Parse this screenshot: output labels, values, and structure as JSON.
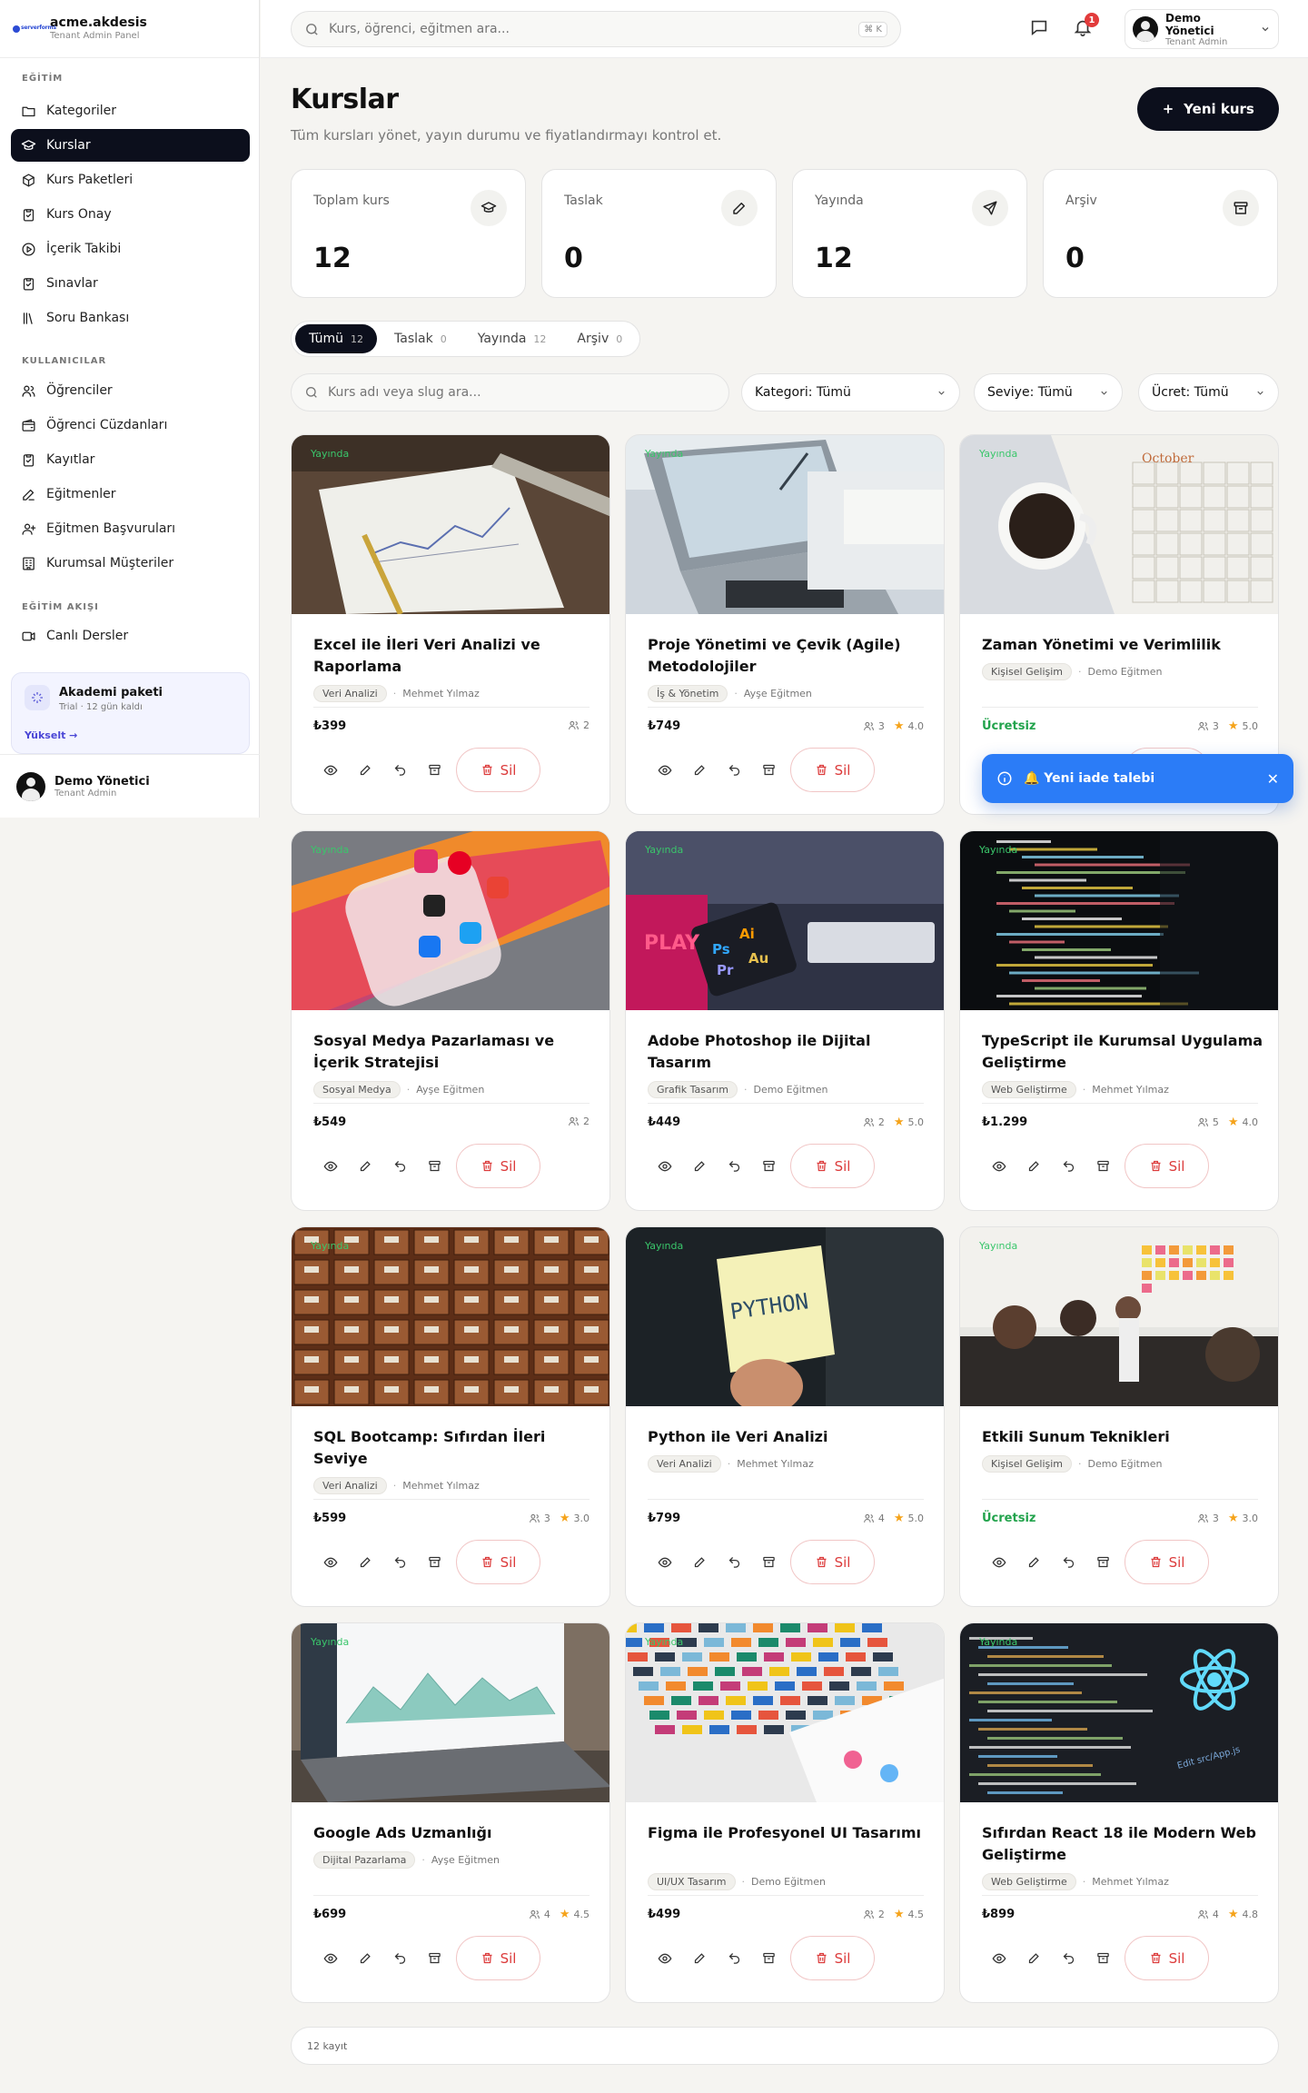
{
  "brand": {
    "logo_text": "serverforms",
    "name": "acme.akdesis",
    "sub": "Tenant Admin Panel"
  },
  "sidebar": {
    "sections": [
      "EĞİTİM",
      "KULLANICILAR",
      "EĞİTİM AKIŞI"
    ],
    "items": [
      {
        "label": "Kategoriler",
        "icon": "folder-icon"
      },
      {
        "label": "Kurslar",
        "icon": "graduation-cap-icon",
        "active": true
      },
      {
        "label": "Kurs Paketleri",
        "icon": "package-icon"
      },
      {
        "label": "Kurs Onay",
        "icon": "clipboard-check-icon"
      },
      {
        "label": "İçerik Takibi",
        "icon": "play-circle-icon"
      },
      {
        "label": "Sınavlar",
        "icon": "clipboard-icon"
      },
      {
        "label": "Soru Bankası",
        "icon": "library-icon"
      },
      {
        "label": "Öğrenciler",
        "icon": "users-icon"
      },
      {
        "label": "Öğrenci Cüzdanları",
        "icon": "wallet-icon"
      },
      {
        "label": "Kayıtlar",
        "icon": "clipboard-list-icon"
      },
      {
        "label": "Eğitmenler",
        "icon": "pen-icon"
      },
      {
        "label": "Eğitmen Başvuruları",
        "icon": "user-plus-icon"
      },
      {
        "label": "Kurumsal Müşteriler",
        "icon": "building-icon"
      },
      {
        "label": "Canlı Dersler",
        "icon": "video-icon"
      }
    ],
    "promo": {
      "title": "Akademi paketi",
      "sub": "Trial · 12 gün kaldı",
      "link": "Yükselt →"
    },
    "user": {
      "name": "Demo Yönetici",
      "role": "Tenant Admin"
    }
  },
  "topbar": {
    "search_placeholder": "Kurs, öğrenci, eğitmen ara...",
    "kbd": "⌘ K",
    "notifications": "1",
    "user": {
      "name": "Demo Yönetici",
      "role": "Tenant Admin"
    }
  },
  "page": {
    "title": "Kurslar",
    "subtitle": "Tüm kursları yönet, yayın durumu ve fiyatlandırmayı kontrol et.",
    "new_button": "Yeni kurs"
  },
  "stats": [
    {
      "label": "Toplam kurs",
      "value": "12",
      "icon": "graduation-cap-icon"
    },
    {
      "label": "Taslak",
      "value": "0",
      "icon": "pencil-icon"
    },
    {
      "label": "Yayında",
      "value": "12",
      "icon": "send-icon"
    },
    {
      "label": "Arşiv",
      "value": "0",
      "icon": "archive-icon"
    }
  ],
  "tabs": [
    {
      "label": "Tümü",
      "count": "12",
      "active": true
    },
    {
      "label": "Taslak",
      "count": "0"
    },
    {
      "label": "Yayında",
      "count": "12"
    },
    {
      "label": "Arşiv",
      "count": "0"
    }
  ],
  "filters": {
    "search_placeholder": "Kurs adı veya slug ara...",
    "category": "Kategori: Tümü",
    "level": "Seviye: Tümü",
    "price": "Ücret: Tümü"
  },
  "status_label": "Yayında",
  "delete_label": "Sil",
  "courses": [
    {
      "title": "Excel ile İleri Veri Analizi ve Raporlama",
      "tag": "Veri Analizi",
      "instructor": "Mehmet Yılmaz",
      "price": "₺399",
      "students": "2",
      "rating": "",
      "theme": "chart"
    },
    {
      "title": "Proje Yönetimi ve Çevik (Agile) Metodolojiler",
      "tag": "İş & Yönetim",
      "instructor": "Ayşe Eğitmen",
      "price": "₺749",
      "students": "3",
      "rating": "4.0",
      "theme": "laptop"
    },
    {
      "title": "Zaman Yönetimi ve Verimlilik",
      "tag": "Kişisel Gelişim",
      "instructor": "Demo Eğitmen",
      "price": "Ücretsiz",
      "free": true,
      "students": "3",
      "rating": "5.0",
      "theme": "calendar"
    },
    {
      "title": "Sosyal Medya Pazarlaması ve İçerik Stratejisi",
      "tag": "Sosyal Medya",
      "instructor": "Ayşe Eğitmen",
      "price": "₺549",
      "students": "2",
      "rating": "",
      "theme": "social"
    },
    {
      "title": "Adobe Photoshop ile Dijital Tasarım",
      "tag": "Grafik Tasarım",
      "instructor": "Demo Eğitmen",
      "price": "₺449",
      "students": "2",
      "rating": "5.0",
      "theme": "adobe"
    },
    {
      "title": "TypeScript ile Kurumsal Uygulama Geliştirme",
      "tag": "Web Geliştirme",
      "instructor": "Mehmet Yılmaz",
      "price": "₺1.299",
      "students": "5",
      "rating": "4.0",
      "theme": "code"
    },
    {
      "title": "SQL Bootcamp: Sıfırdan İleri Seviye",
      "tag": "Veri Analizi",
      "instructor": "Mehmet Yılmaz",
      "price": "₺599",
      "students": "3",
      "rating": "3.0",
      "theme": "drawers"
    },
    {
      "title": "Python ile Veri Analizi",
      "tag": "Veri Analizi",
      "instructor": "Mehmet Yılmaz",
      "price": "₺799",
      "students": "4",
      "rating": "5.0",
      "theme": "python"
    },
    {
      "title": "Etkili Sunum Teknikleri",
      "tag": "Kişisel Gelişim",
      "instructor": "Demo Eğitmen",
      "price": "Ücretsiz",
      "free": true,
      "students": "3",
      "rating": "3.0",
      "theme": "meeting"
    },
    {
      "title": "Google Ads Uzmanlığı",
      "tag": "Dijital Pazarlama",
      "instructor": "Ayşe Eğitmen",
      "price": "₺699",
      "students": "4",
      "rating": "4.5",
      "theme": "analytics"
    },
    {
      "title": "Figma ile Profesyonel UI Tasarımı",
      "tag": "UI/UX Tasarım",
      "instructor": "Demo Eğitmen",
      "price": "₺499",
      "students": "2",
      "rating": "4.5",
      "theme": "swatches"
    },
    {
      "title": "Sıfırdan React 18 ile Modern Web Geliştirme",
      "tag": "Web Geliştirme",
      "instructor": "Mehmet Yılmaz",
      "price": "₺899",
      "students": "4",
      "rating": "4.8",
      "theme": "react"
    }
  ],
  "toast": {
    "text": "🔔 Yeni iade talebi"
  },
  "footer": {
    "count": "12 kayıt"
  }
}
